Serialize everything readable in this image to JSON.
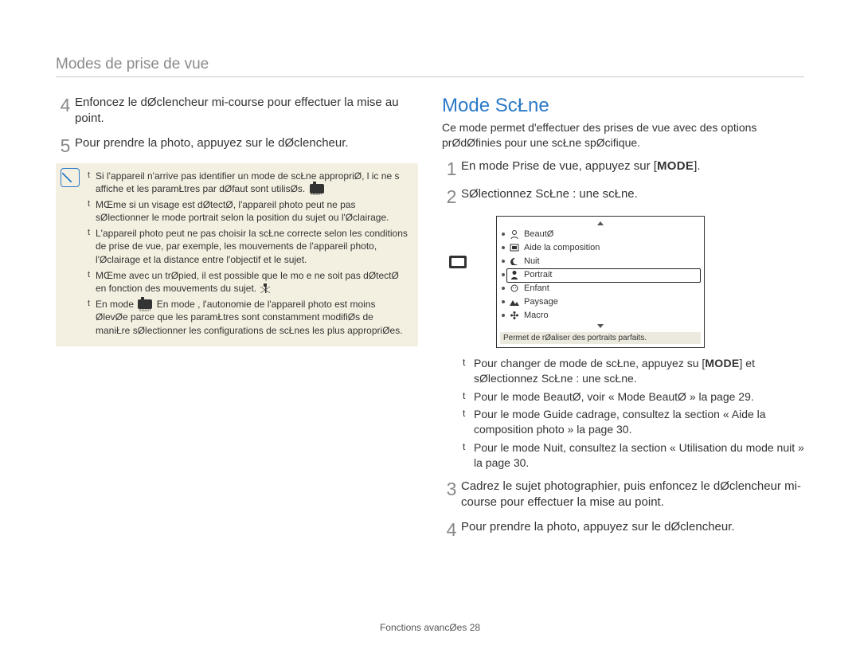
{
  "header": "Modes de prise de vue",
  "left": {
    "steps": [
      {
        "num": "4",
        "text": "Enfoncez le dØclencheur   mi-course pour effectuer la mise au point."
      },
      {
        "num": "5",
        "text": "Pour prendre la photo, appuyez sur le dØclencheur."
      }
    ],
    "notes": [
      "Si l'appareil n'arrive pas   identifier un mode de scŁne appropriØ, l ic ne        s affiche et les paramŁtres par dØfaut sont utilisØs.",
      "MŒme si un visage est dØtectØ, l'appareil photo peut ne pas sØlectionner le mode portrait selon la position du sujet ou l'Øclairage.",
      "L'appareil photo peut ne pas choisir la scŁne correcte selon les conditions de prise de vue, par exemple, les mouvements de l'appareil photo, l'Øclairage et la distance entre l'objectif et le sujet.",
      "MŒme avec un trØpied, il est possible que le mo e      ne soit pas dØtectØ en fonction des mouvements du sujet.",
      "En mode       , l'autonomie de l'appareil photo est moins ØlevØe parce que les paramŁtres sont constamment modifiØs de maniŁre   sØlectionner les configurations de scŁnes les plus appropriØes."
    ]
  },
  "right": {
    "title": "Mode ScŁne",
    "desc": "Ce mode permet d'effectuer des prises de vue avec des options prØdØfinies pour une scŁne spØcifique.",
    "step1_pre": "En mode Prise de vue, appuyez sur [",
    "step1_mode": "MODE",
    "step1_post": "].",
    "step2": "SØlectionnez ScŁne  : une scŁne.",
    "scene_menu": {
      "items": [
        {
          "label": "BeautØ"
        },
        {
          "label": "Aide   la composition"
        },
        {
          "label": "Nuit"
        },
        {
          "label": "Portrait",
          "selected": true
        },
        {
          "label": "Enfant"
        },
        {
          "label": "Paysage"
        },
        {
          "label": "Macro"
        }
      ],
      "description": "Permet de rØaliser des portraits parfaits."
    },
    "tips": [
      {
        "pre": "Pour changer de mode de scŁne, appuyez su [",
        "mode": "MODE",
        "post": "] et sØlectionnez ScŁne  : une scŁne."
      },
      {
        "text": "Pour le mode BeautØ, voir « Mode BeautØ »   la page 29."
      },
      {
        "text": "Pour le mode Guide cadrage, consultez la section « Aide   la composition photo »   la page 30."
      },
      {
        "text": "Pour le mode Nuit, consultez la section « Utilisation du mode nuit »   la page 30."
      }
    ],
    "step3": "Cadrez le sujet   photographier, puis enfoncez le dØclencheur   mi-course pour effectuer la mise au point.",
    "step4": "Pour prendre la photo, appuyez sur le dØclencheur."
  },
  "footer_label": "Fonctions avancØes",
  "footer_page": "28"
}
